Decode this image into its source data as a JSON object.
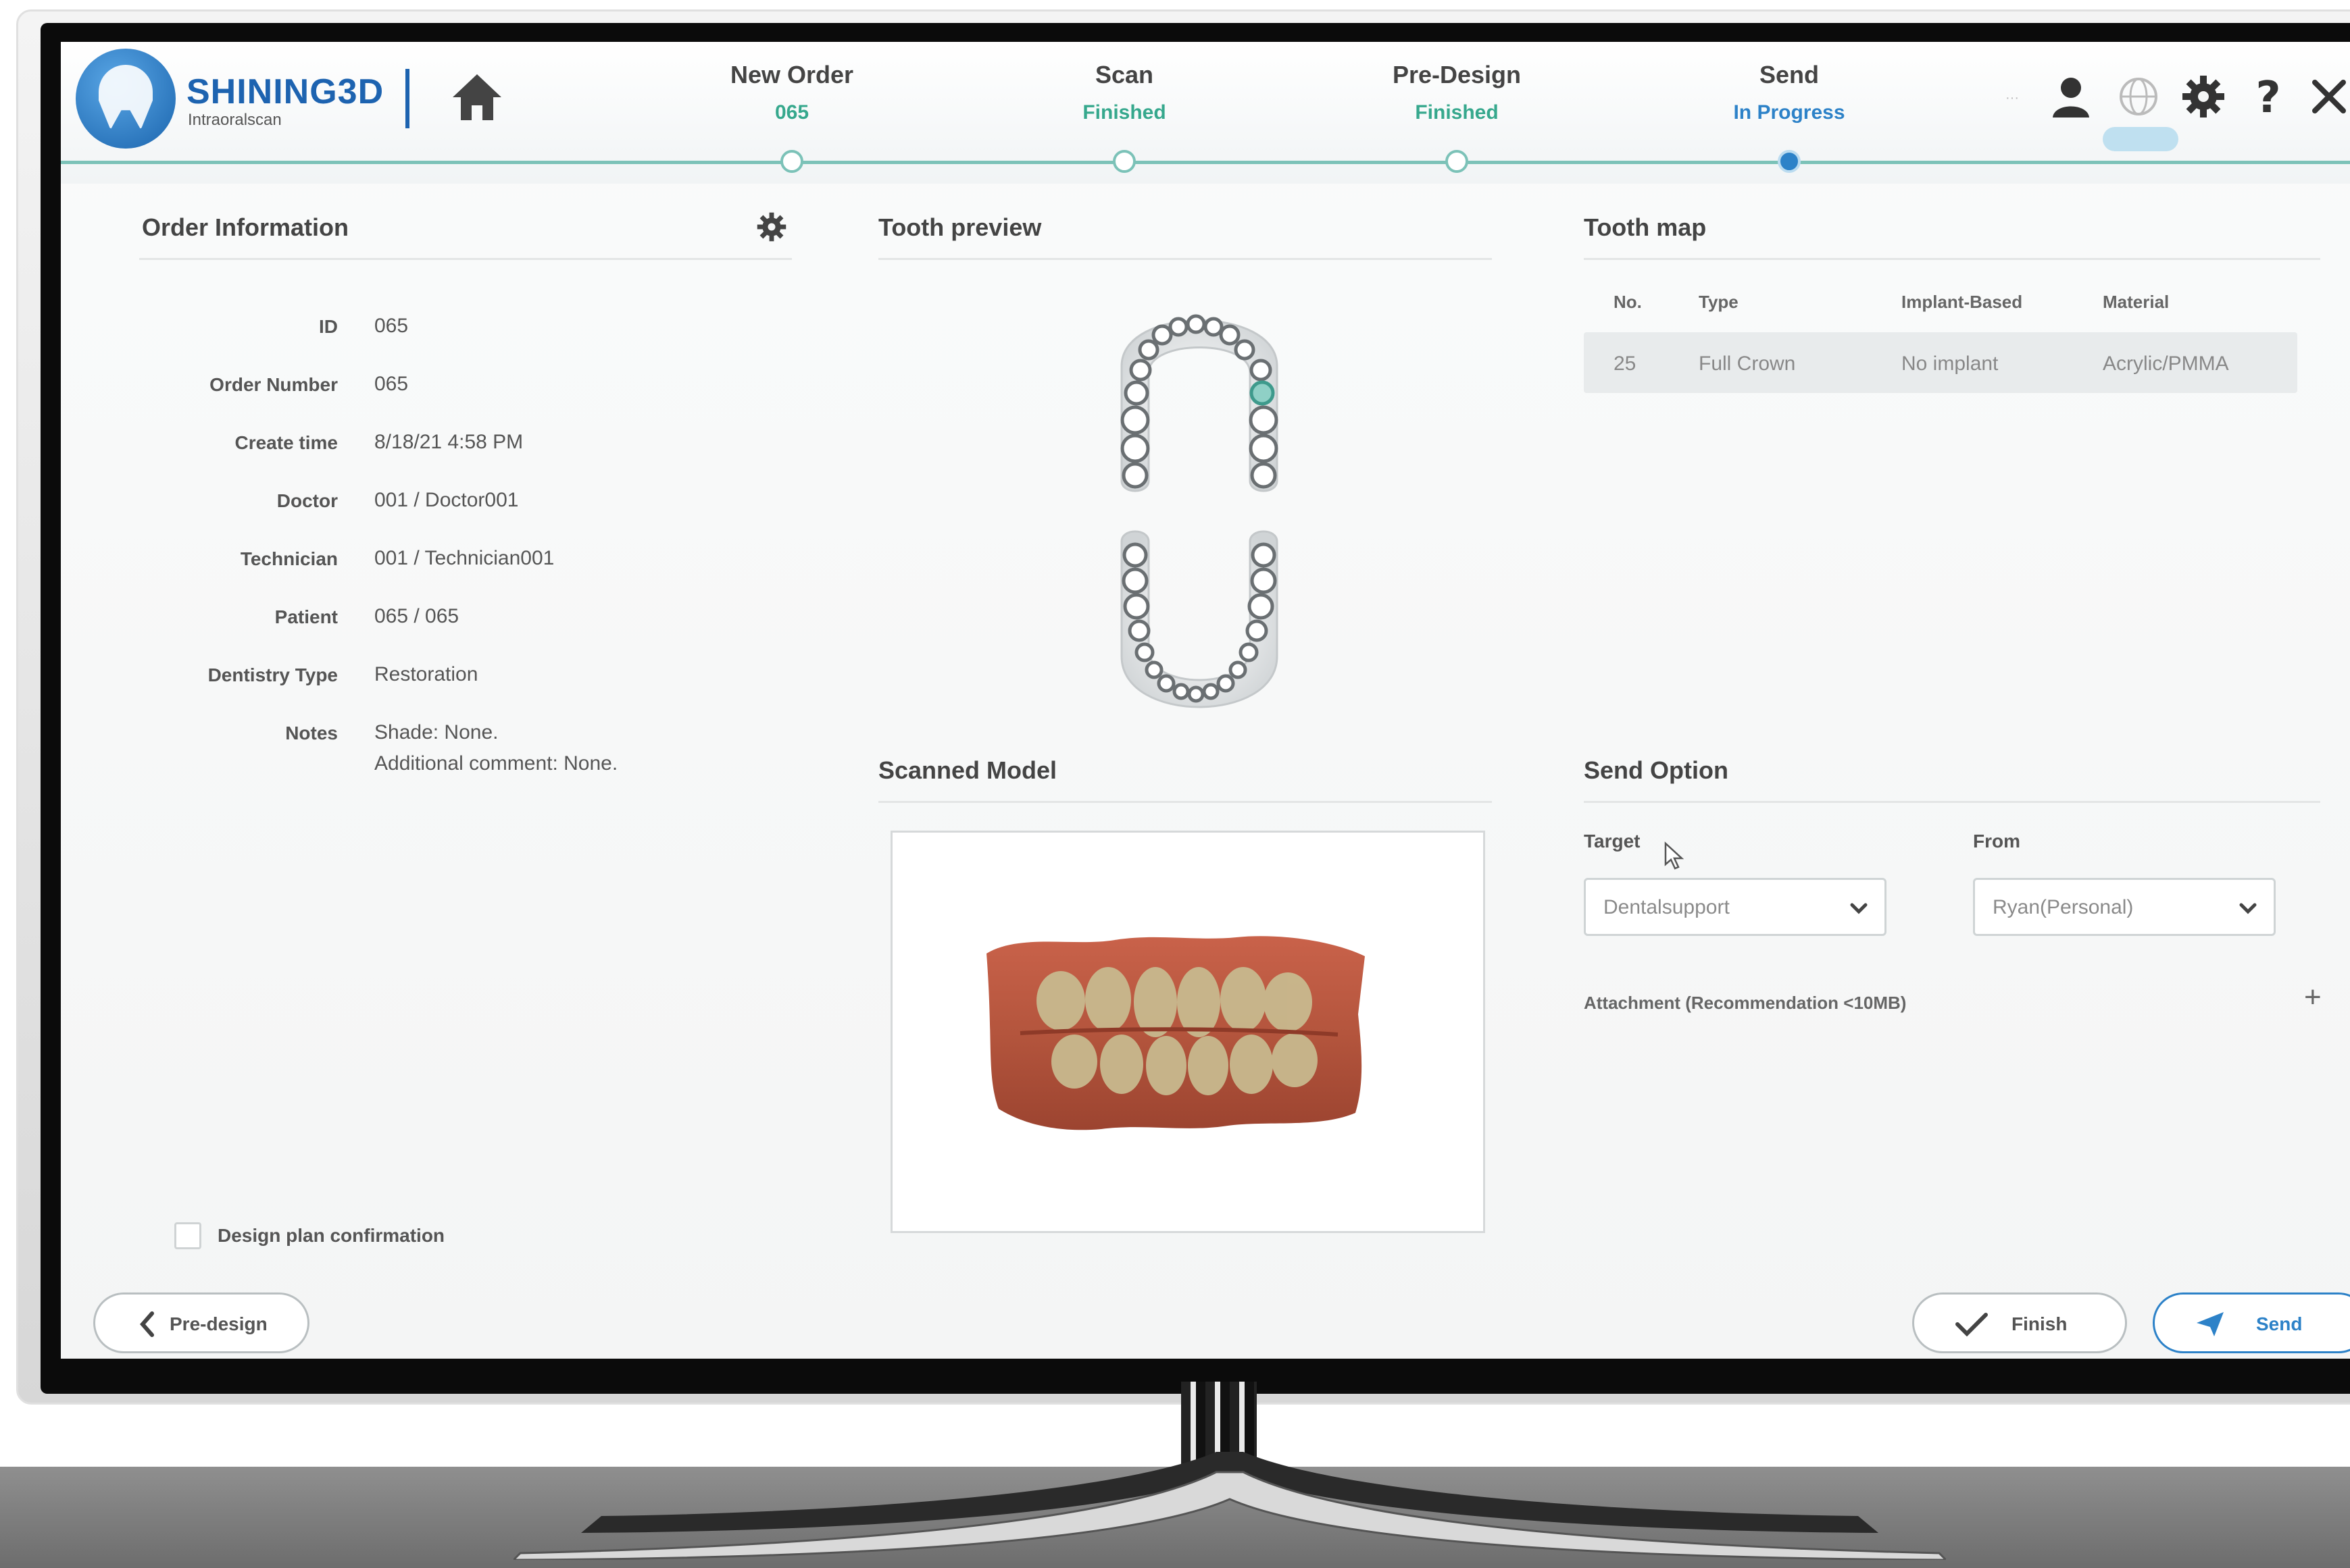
{
  "header": {
    "brand": "SHINING3D",
    "brand_sub": "Intraoralscan",
    "tiny_text": "···",
    "steps": [
      {
        "title": "New Order",
        "status": "065",
        "state": "done"
      },
      {
        "title": "Scan",
        "status": "Finished",
        "state": "done"
      },
      {
        "title": "Pre-Design",
        "status": "Finished",
        "state": "done"
      },
      {
        "title": "Send",
        "status": "In Progress",
        "state": "active"
      }
    ],
    "icons": [
      "user-icon",
      "globe-icon",
      "gear-icon",
      "help-icon",
      "close-icon"
    ]
  },
  "order_info": {
    "title": "Order Information",
    "fields": [
      {
        "label": "ID",
        "value": "065"
      },
      {
        "label": "Order Number",
        "value": "065"
      },
      {
        "label": "Create time",
        "value": "8/18/21 4:58 PM"
      },
      {
        "label": "Doctor",
        "value": "001 / Doctor001"
      },
      {
        "label": "Technician",
        "value": "001 / Technician001"
      },
      {
        "label": "Patient",
        "value": "065 / 065"
      },
      {
        "label": "Dentistry Type",
        "value": "Restoration"
      },
      {
        "label": "Notes",
        "value": "Shade: None.",
        "value2": "Additional comment: None."
      }
    ],
    "confirm_label": "Design plan confirmation",
    "confirm_checked": false
  },
  "tooth_preview": {
    "title": "Tooth preview",
    "selected_tooth": "25"
  },
  "tooth_map": {
    "title": "Tooth map",
    "columns": [
      "No.",
      "Type",
      "Implant-Based",
      "Material"
    ],
    "rows": [
      {
        "no": "25",
        "type": "Full Crown",
        "implant": "No implant",
        "material": "Acrylic/PMMA"
      }
    ]
  },
  "scanned_model": {
    "title": "Scanned Model"
  },
  "send_option": {
    "title": "Send Option",
    "target_label": "Target",
    "target_value": "Dentalsupport",
    "from_label": "From",
    "from_value": "Ryan(Personal)",
    "attachment_label": "Attachment (Recommendation <10MB)",
    "add_symbol": "+"
  },
  "footer": {
    "back_label": "Pre-design",
    "finish_label": "Finish",
    "send_label": "Send"
  },
  "colors": {
    "brand": "#1d63b0",
    "done": "#36a88d",
    "active": "#2d82c8",
    "track": "#7cc2b8"
  }
}
